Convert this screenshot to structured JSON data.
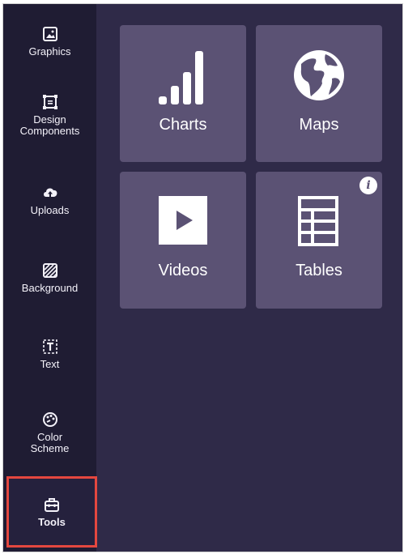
{
  "sidebar": {
    "items": [
      {
        "label": "Graphics",
        "icon": "image-icon"
      },
      {
        "label": "Design\nComponents",
        "icon": "components-icon"
      },
      {
        "label": "Uploads",
        "icon": "cloud-upload-icon"
      },
      {
        "label": "Background",
        "icon": "background-pattern-icon"
      },
      {
        "label": "Text",
        "icon": "text-icon"
      },
      {
        "label": "Color\nScheme",
        "icon": "palette-icon"
      },
      {
        "label": "Tools",
        "icon": "toolbox-icon",
        "active": true
      }
    ]
  },
  "tools": {
    "tiles": [
      {
        "label": "Charts",
        "icon": "bar-chart-icon"
      },
      {
        "label": "Maps",
        "icon": "globe-icon"
      },
      {
        "label": "Videos",
        "icon": "play-icon"
      },
      {
        "label": "Tables",
        "icon": "table-icon",
        "badge": "i"
      }
    ]
  },
  "colors": {
    "sidebar_bg": "#1f1c33",
    "panel_bg": "#2f2a48",
    "tile_bg": "#5b5274",
    "active_outline": "#e4473f"
  }
}
